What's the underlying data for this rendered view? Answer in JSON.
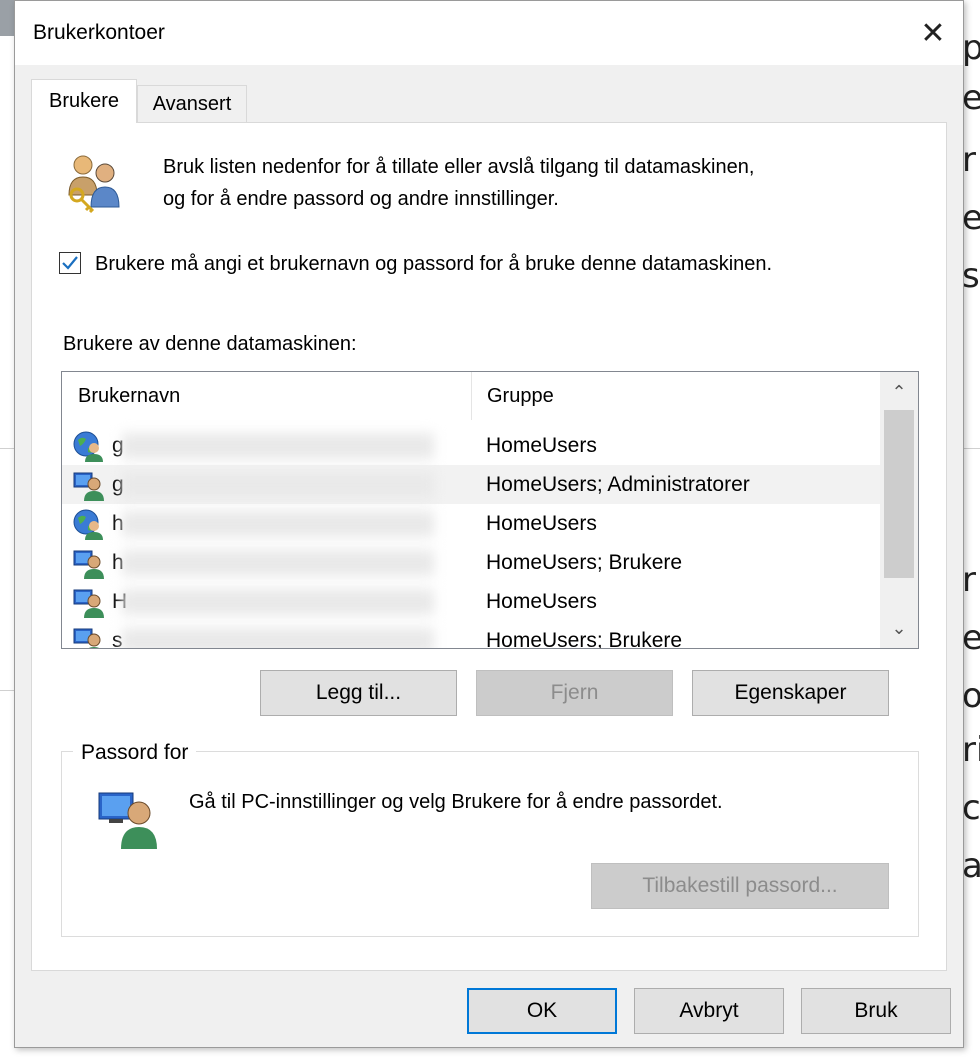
{
  "background": {
    "fragments": [
      "p",
      "e",
      "r",
      "e",
      "s",
      "r",
      "e",
      "o",
      "ri",
      "c",
      "a"
    ]
  },
  "dialog": {
    "title": "Brukerkontoer",
    "close_glyph": "✕"
  },
  "tabs": [
    {
      "label": "Brukere",
      "active": true
    },
    {
      "label": "Avansert",
      "active": false
    }
  ],
  "intro": {
    "line1": "Bruk listen nedenfor for å tillate eller avslå tilgang til datamaskinen,",
    "line2": "og for å endre passord og andre innstillinger.",
    "icon": "users-key-icon"
  },
  "require_login": {
    "checked": true,
    "label": "Brukere må angi et brukernavn og passord for å bruke denne datamaskinen."
  },
  "users_list": {
    "label": "Brukere av denne datamaskinen:",
    "columns": [
      "Brukernavn",
      "Gruppe"
    ],
    "rows": [
      {
        "name": "g",
        "group": "HomeUsers",
        "icon": "globe-user-icon"
      },
      {
        "name": "g",
        "group": "HomeUsers; Administratorer",
        "icon": "local-user-icon",
        "selected": true
      },
      {
        "name": "h",
        "group": "HomeUsers",
        "icon": "globe-user-icon"
      },
      {
        "name": "h",
        "group": "HomeUsers; Brukere",
        "icon": "local-user-icon"
      },
      {
        "name": "H",
        "group": "HomeUsers",
        "icon": "local-user-icon"
      },
      {
        "name": "s",
        "group": "HomeUsers; Brukere",
        "icon": "local-user-icon"
      }
    ],
    "scroll_up": "⌃",
    "scroll_down": "⌄"
  },
  "list_buttons": {
    "add": "Legg til...",
    "remove": "Fjern",
    "properties": "Egenskaper"
  },
  "password": {
    "group_title": "Passord for",
    "text": "Gå til PC-innstillinger og velg Brukere for å endre passordet.",
    "reset_button": "Tilbakestill passord..."
  },
  "footer": {
    "ok": "OK",
    "cancel": "Avbryt",
    "apply": "Bruk"
  },
  "colors": {
    "accent": "#0078d7",
    "checkbox": "#1a6fc0"
  }
}
